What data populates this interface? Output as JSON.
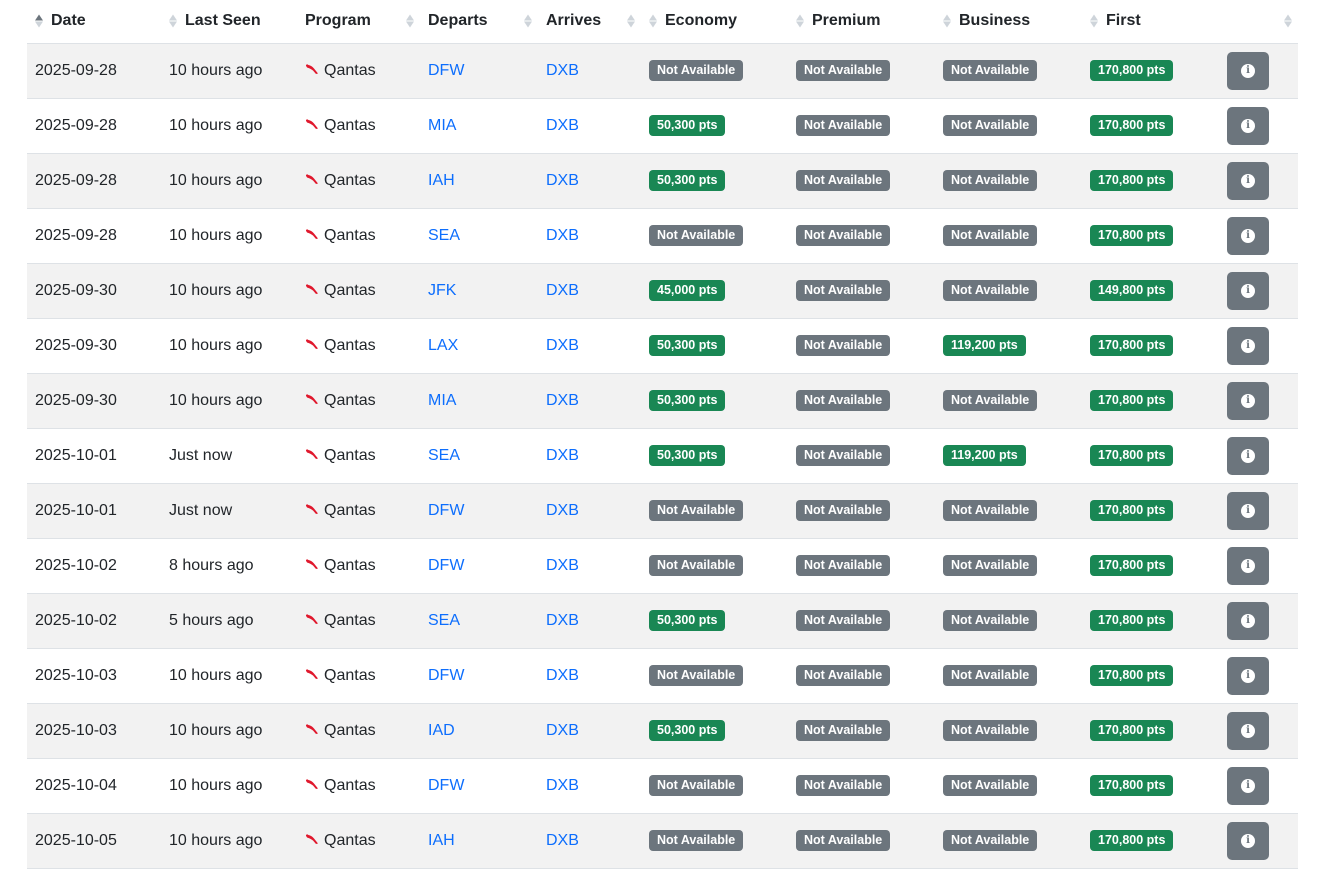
{
  "colors": {
    "available": "#198754",
    "not_available": "#6c757d",
    "link": "#0d6efd",
    "qantas_red": "#e0182d",
    "stripe": "#f2f2f2"
  },
  "table": {
    "headers": {
      "date": "Date",
      "last_seen": "Last Seen",
      "program": "Program",
      "departs": "Departs",
      "arrives": "Arrives",
      "economy": "Economy",
      "premium": "Premium",
      "business": "Business",
      "first": "First"
    },
    "sort": {
      "column": "date",
      "direction": "ascending"
    },
    "row_icons": {
      "program": "qantas-kangaroo-icon",
      "details": "info-circle-icon"
    },
    "rows": [
      {
        "date": "2025-09-28",
        "last_seen": "10 hours ago",
        "program": "Qantas",
        "departs": "DFW",
        "arrives": "DXB",
        "economy": "Not Available",
        "premium": "Not Available",
        "business": "Not Available",
        "first": "170,800 pts"
      },
      {
        "date": "2025-09-28",
        "last_seen": "10 hours ago",
        "program": "Qantas",
        "departs": "MIA",
        "arrives": "DXB",
        "economy": "50,300 pts",
        "premium": "Not Available",
        "business": "Not Available",
        "first": "170,800 pts"
      },
      {
        "date": "2025-09-28",
        "last_seen": "10 hours ago",
        "program": "Qantas",
        "departs": "IAH",
        "arrives": "DXB",
        "economy": "50,300 pts",
        "premium": "Not Available",
        "business": "Not Available",
        "first": "170,800 pts"
      },
      {
        "date": "2025-09-28",
        "last_seen": "10 hours ago",
        "program": "Qantas",
        "departs": "SEA",
        "arrives": "DXB",
        "economy": "Not Available",
        "premium": "Not Available",
        "business": "Not Available",
        "first": "170,800 pts"
      },
      {
        "date": "2025-09-30",
        "last_seen": "10 hours ago",
        "program": "Qantas",
        "departs": "JFK",
        "arrives": "DXB",
        "economy": "45,000 pts",
        "premium": "Not Available",
        "business": "Not Available",
        "first": "149,800 pts"
      },
      {
        "date": "2025-09-30",
        "last_seen": "10 hours ago",
        "program": "Qantas",
        "departs": "LAX",
        "arrives": "DXB",
        "economy": "50,300 pts",
        "premium": "Not Available",
        "business": "119,200 pts",
        "first": "170,800 pts"
      },
      {
        "date": "2025-09-30",
        "last_seen": "10 hours ago",
        "program": "Qantas",
        "departs": "MIA",
        "arrives": "DXB",
        "economy": "50,300 pts",
        "premium": "Not Available",
        "business": "Not Available",
        "first": "170,800 pts"
      },
      {
        "date": "2025-10-01",
        "last_seen": "Just now",
        "program": "Qantas",
        "departs": "SEA",
        "arrives": "DXB",
        "economy": "50,300 pts",
        "premium": "Not Available",
        "business": "119,200 pts",
        "first": "170,800 pts"
      },
      {
        "date": "2025-10-01",
        "last_seen": "Just now",
        "program": "Qantas",
        "departs": "DFW",
        "arrives": "DXB",
        "economy": "Not Available",
        "premium": "Not Available",
        "business": "Not Available",
        "first": "170,800 pts"
      },
      {
        "date": "2025-10-02",
        "last_seen": "8 hours ago",
        "program": "Qantas",
        "departs": "DFW",
        "arrives": "DXB",
        "economy": "Not Available",
        "premium": "Not Available",
        "business": "Not Available",
        "first": "170,800 pts"
      },
      {
        "date": "2025-10-02",
        "last_seen": "5 hours ago",
        "program": "Qantas",
        "departs": "SEA",
        "arrives": "DXB",
        "economy": "50,300 pts",
        "premium": "Not Available",
        "business": "Not Available",
        "first": "170,800 pts"
      },
      {
        "date": "2025-10-03",
        "last_seen": "10 hours ago",
        "program": "Qantas",
        "departs": "DFW",
        "arrives": "DXB",
        "economy": "Not Available",
        "premium": "Not Available",
        "business": "Not Available",
        "first": "170,800 pts"
      },
      {
        "date": "2025-10-03",
        "last_seen": "10 hours ago",
        "program": "Qantas",
        "departs": "IAD",
        "arrives": "DXB",
        "economy": "50,300 pts",
        "premium": "Not Available",
        "business": "Not Available",
        "first": "170,800 pts"
      },
      {
        "date": "2025-10-04",
        "last_seen": "10 hours ago",
        "program": "Qantas",
        "departs": "DFW",
        "arrives": "DXB",
        "economy": "Not Available",
        "premium": "Not Available",
        "business": "Not Available",
        "first": "170,800 pts"
      },
      {
        "date": "2025-10-05",
        "last_seen": "10 hours ago",
        "program": "Qantas",
        "departs": "IAH",
        "arrives": "DXB",
        "economy": "Not Available",
        "premium": "Not Available",
        "business": "Not Available",
        "first": "170,800 pts"
      }
    ]
  }
}
